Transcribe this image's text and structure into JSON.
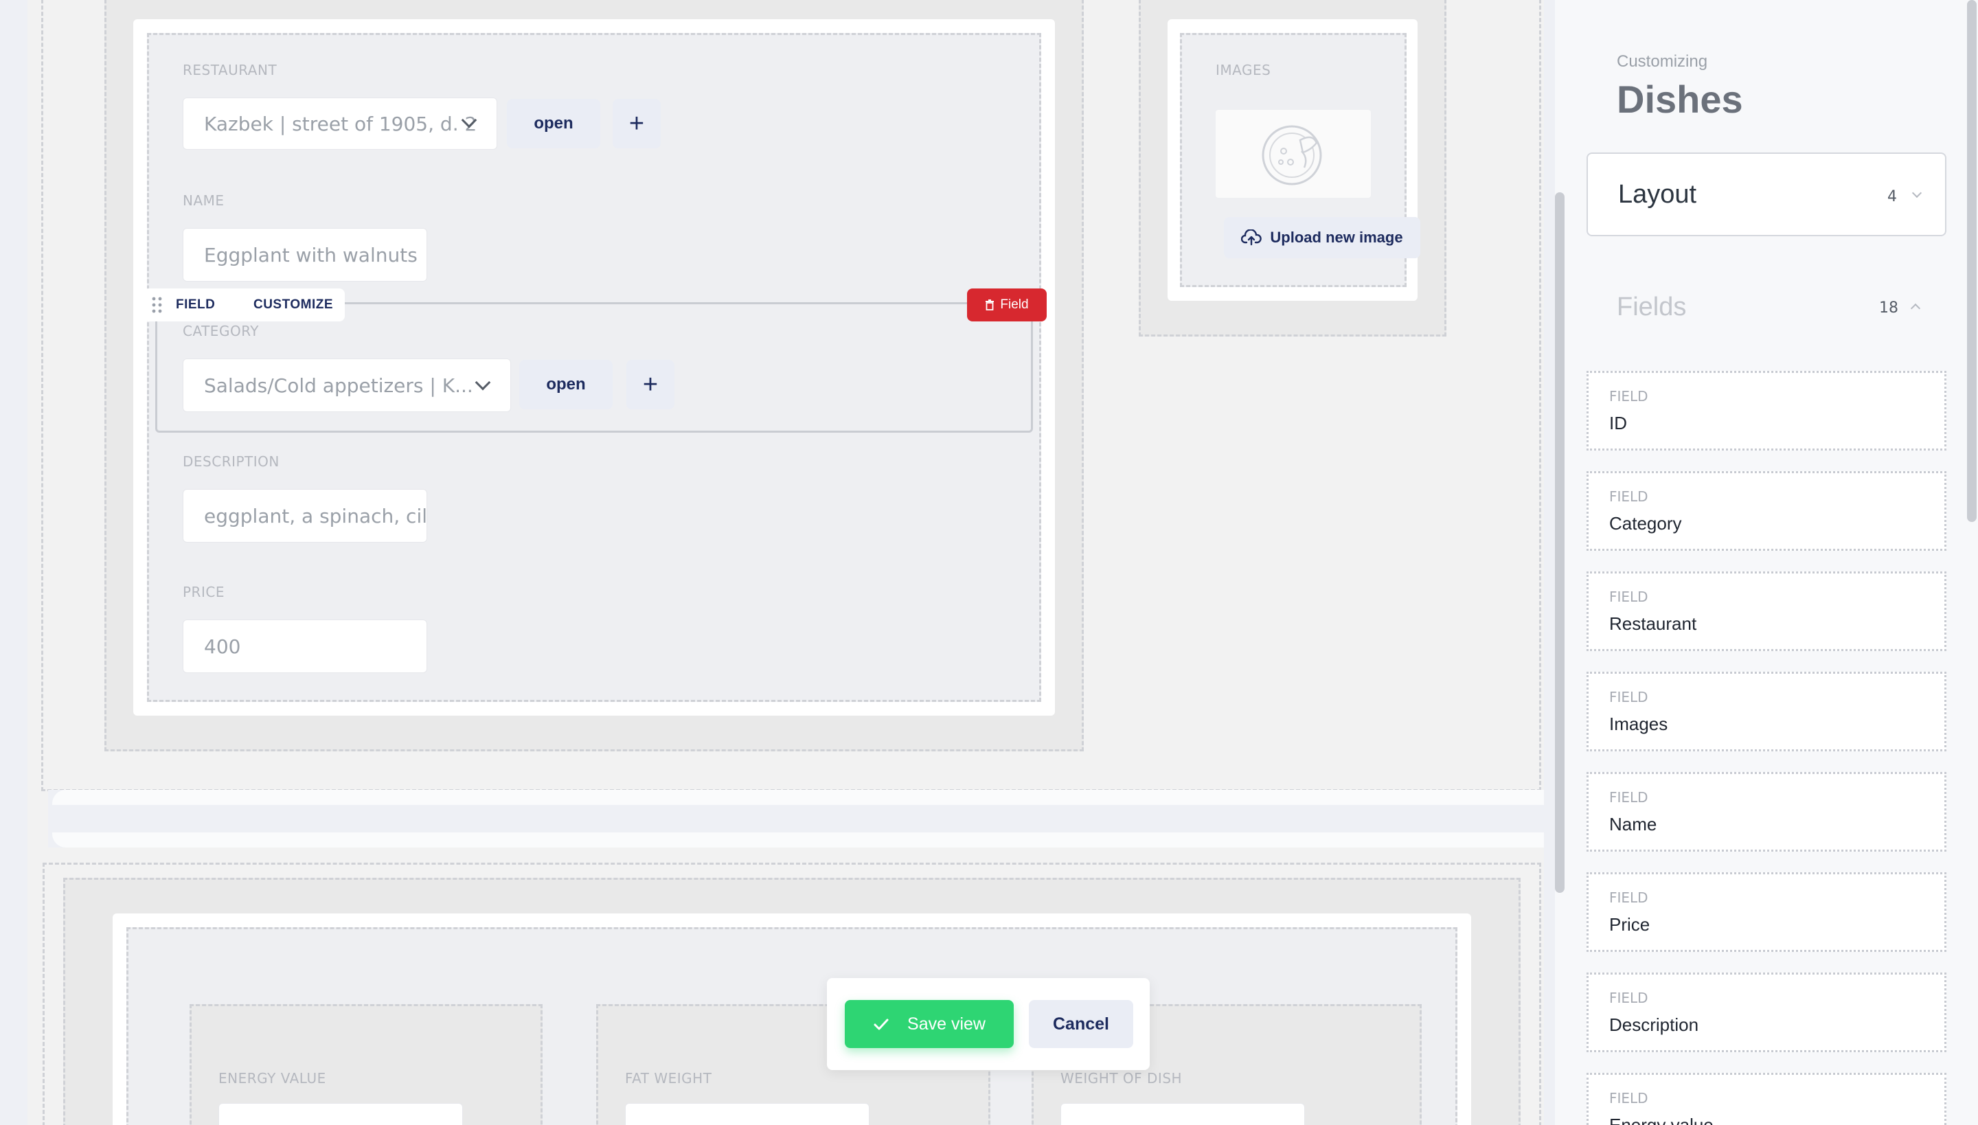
{
  "form": {
    "restaurant": {
      "label": "RESTAURANT",
      "value": "Kazbek | street of 1905, d. 2",
      "open_label": "open",
      "add_label": "+"
    },
    "name": {
      "label": "NAME",
      "value": "Eggplant with walnuts"
    },
    "field_toolbar": {
      "field_label": "FIELD",
      "customize_label": "CUSTOMIZE",
      "delete_label": "Field"
    },
    "category": {
      "label": "CATEGORY",
      "value": "Salads/Cold appetizers | K...",
      "open_label": "open",
      "add_label": "+"
    },
    "description": {
      "label": "DESCRIPTION",
      "value": "eggplant, a spinach, cil"
    },
    "price": {
      "label": "PRICE",
      "value": "400"
    },
    "images": {
      "label": "IMAGES",
      "upload_label": "Upload new image"
    },
    "bottom": {
      "energy_label": "ENERGY VALUE",
      "fat_label": "FAT WEIGHT",
      "weight_label": "WEIGHT OF DISH"
    }
  },
  "dialog": {
    "save_label": "Save view",
    "cancel_label": "Cancel"
  },
  "sidebar": {
    "subtitle": "Customizing",
    "title": "Dishes",
    "layout": {
      "label": "Layout",
      "count": "4"
    },
    "fields": {
      "label": "Fields",
      "count": "18"
    },
    "field_caption": "FIELD",
    "items": [
      {
        "name": "ID"
      },
      {
        "name": "Category"
      },
      {
        "name": "Restaurant"
      },
      {
        "name": "Images"
      },
      {
        "name": "Name"
      },
      {
        "name": "Price"
      },
      {
        "name": "Description"
      },
      {
        "name": "Energy value"
      }
    ]
  },
  "colors": {
    "save_green": "#2ed573",
    "delete_red": "#d7282f",
    "accent_navy": "#1d2b5e"
  }
}
